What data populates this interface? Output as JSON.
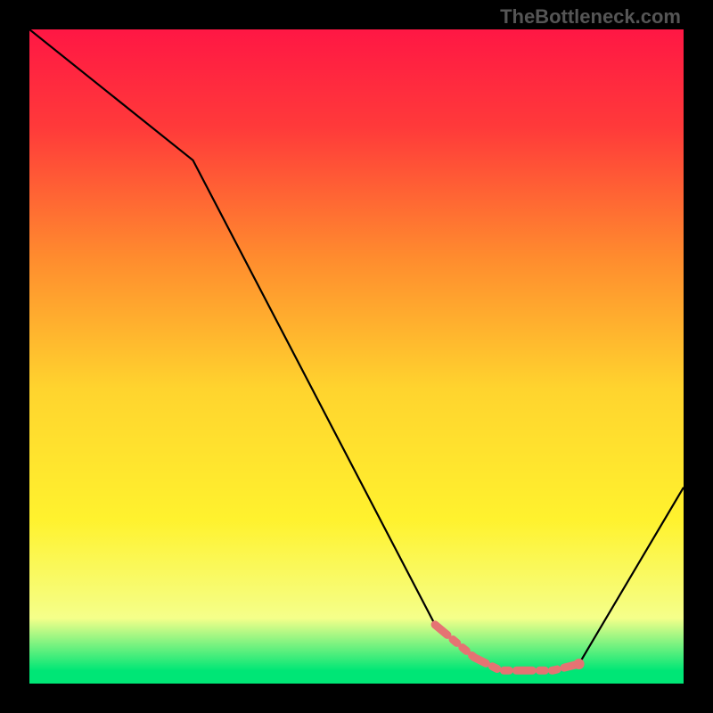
{
  "watermark": "TheBottleneck.com",
  "chart_data": {
    "type": "line",
    "title": "",
    "xlabel": "",
    "ylabel": "",
    "xlim": [
      0,
      100
    ],
    "ylim": [
      0,
      100
    ],
    "curve": {
      "x": [
        0,
        25,
        62,
        68,
        72,
        76,
        80,
        84,
        100
      ],
      "y": [
        100,
        80,
        9,
        4,
        2,
        2,
        2,
        3,
        30
      ]
    },
    "highlight_segment": {
      "x": [
        62,
        68,
        72,
        76,
        80,
        84
      ],
      "y": [
        9,
        4,
        2,
        2,
        2,
        3
      ]
    },
    "background_gradient_stops": [
      {
        "pos": 0.0,
        "color": "#ff1744"
      },
      {
        "pos": 0.15,
        "color": "#ff3a3a"
      },
      {
        "pos": 0.35,
        "color": "#ff8c2e"
      },
      {
        "pos": 0.55,
        "color": "#ffd42e"
      },
      {
        "pos": 0.75,
        "color": "#fff22e"
      },
      {
        "pos": 0.9,
        "color": "#f5ff8a"
      },
      {
        "pos": 0.98,
        "color": "#00e676"
      },
      {
        "pos": 1.0,
        "color": "#00e676"
      }
    ]
  }
}
